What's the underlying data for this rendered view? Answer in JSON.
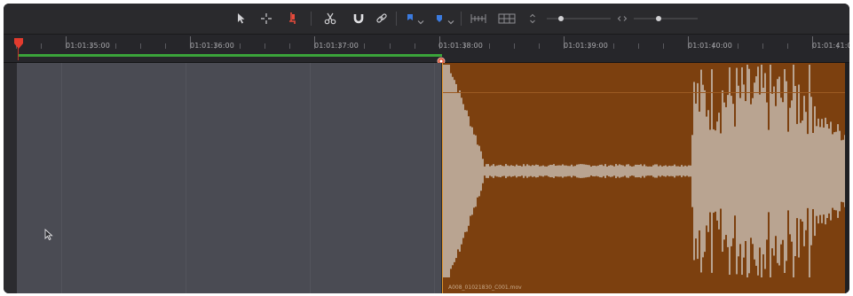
{
  "toolbar": {
    "tools": [
      {
        "name": "selection-tool-icon",
        "active": false
      },
      {
        "name": "trim-tool-icon",
        "active": false
      },
      {
        "name": "dynamic-trim-tool-icon",
        "active": true
      },
      {
        "name": "blade-tool-icon",
        "active": false
      },
      {
        "name": "snapping-icon",
        "active": false
      },
      {
        "name": "linked-selection-icon",
        "active": false
      },
      {
        "name": "flag-icon",
        "active": false
      },
      {
        "name": "marker-icon",
        "active": false
      }
    ],
    "accent_color": "#e64a3b",
    "flag_color": "#3b7be0"
  },
  "ruler": {
    "timecodes": [
      "01:01:35:00",
      "01:01:36:00",
      "01:01:37:00",
      "01:01:38:00",
      "01:01:39:00",
      "01:01:40:00",
      "01:01:41:0"
    ]
  },
  "clip": {
    "name": "A008_01021830_C001.mov",
    "color": "#7c400f"
  },
  "colors": {
    "gap": "#4a4b53",
    "in_out_range": "#3aa33a",
    "playhead": "#c0392b"
  }
}
